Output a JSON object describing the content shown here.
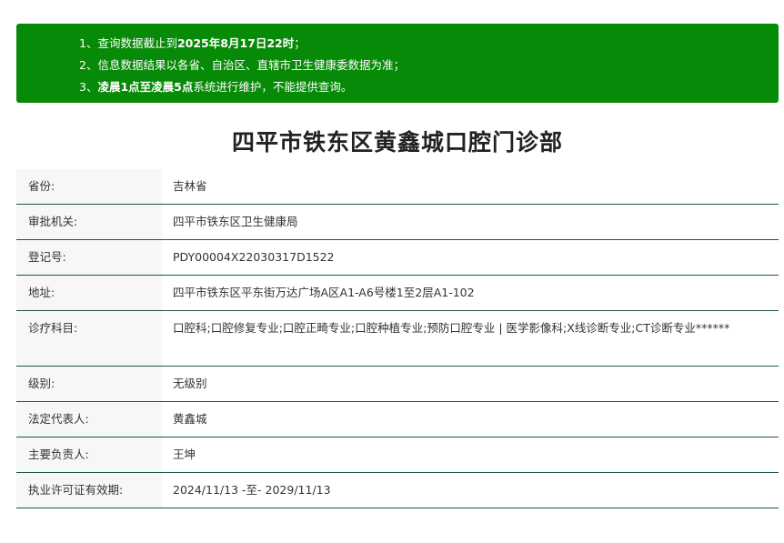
{
  "notice": {
    "line1_prefix": "1、查询数据截止到",
    "line1_bold": "2025年8月17日22时",
    "line1_suffix": "；",
    "line2": "2、信息数据结果以各省、自治区、直辖市卫生健康委数据为准；",
    "line3_prefix": "3、",
    "line3_bold": "凌晨1点至凌晨5点",
    "line3_suffix": "系统进行维护，不能提供查询。",
    "background_color": "#078a07"
  },
  "title": "四平市铁东区黄鑫城口腔门诊部",
  "fields": {
    "province": {
      "label": "省份:",
      "value": "吉林省"
    },
    "approval_authority": {
      "label": "审批机关:",
      "value": "四平市铁东区卫生健康局"
    },
    "registration_no": {
      "label": "登记号:",
      "value": "PDY00004X22030317D1522"
    },
    "address": {
      "label": "地址:",
      "value": "四平市铁东区平东街万达广场A区A1-A6号楼1至2层A1-102"
    },
    "departments": {
      "label": "诊疗科目:",
      "value": "口腔科;口腔修复专业;口腔正畸专业;口腔种植专业;预防口腔专业 | 医学影像科;X线诊断专业;CT诊断专业******"
    },
    "level": {
      "label": "级别:",
      "value": "无级别"
    },
    "legal_representative": {
      "label": "法定代表人:",
      "value": "黄鑫城"
    },
    "principal": {
      "label": "主要负责人:",
      "value": "王坤"
    },
    "license_validity": {
      "label": "执业许可证有效期:",
      "value": "2024/11/13 -至- 2029/11/13"
    }
  }
}
